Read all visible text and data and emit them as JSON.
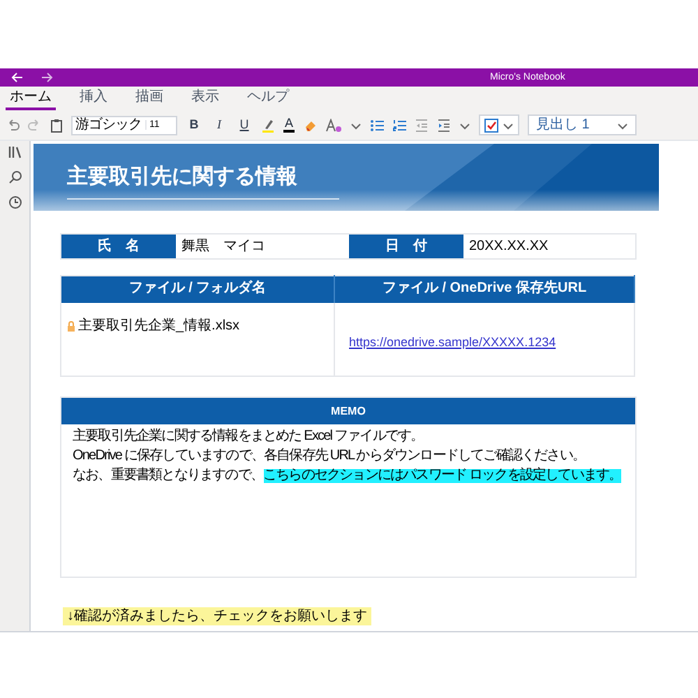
{
  "window": {
    "title": "Micro's Notebook"
  },
  "ribbon": {
    "tabs": [
      {
        "label": "ホーム",
        "selected": true
      },
      {
        "label": "挿入",
        "selected": false
      },
      {
        "label": "描画",
        "selected": false
      },
      {
        "label": "表示",
        "selected": false
      },
      {
        "label": "ヘルプ",
        "selected": false
      }
    ]
  },
  "toolbar": {
    "font_name": "游ゴシック",
    "font_size": "11",
    "format_buttons": [
      "B",
      "I",
      "U"
    ],
    "font_color_button": "A",
    "style": "見出し 1",
    "tag_checked": true
  },
  "page": {
    "title": "主要取引先に関する情報",
    "info": [
      {
        "label": "氏　名",
        "value": "舞黒　マイコ"
      },
      {
        "label": "日　付",
        "value": "20XX.XX.XX"
      }
    ],
    "file_table": {
      "columns": [
        "ファイル / フォルダ名",
        "ファイル / OneDrive 保存先URL"
      ],
      "rows": [
        {
          "file": "主要取引先企業_情報.xlsx",
          "url": "https://onedrive.sample/XXXXX.1234"
        }
      ]
    },
    "memo": {
      "title": "MEMO",
      "lines": [
        {
          "text": "主要取引先企業に関する情報をまとめた Excel ファイルです。"
        },
        {
          "text": "OneDrive に保存していますので、各自保存先 URL からダウンロードしてご確認ください。"
        },
        {
          "text": "なお、重要書類となりますので、",
          "highlight": "こちらのセクションにはパスワード ロックを設定しています。"
        }
      ]
    },
    "note": "↓確認が済みましたら、チェックをお願いします"
  }
}
